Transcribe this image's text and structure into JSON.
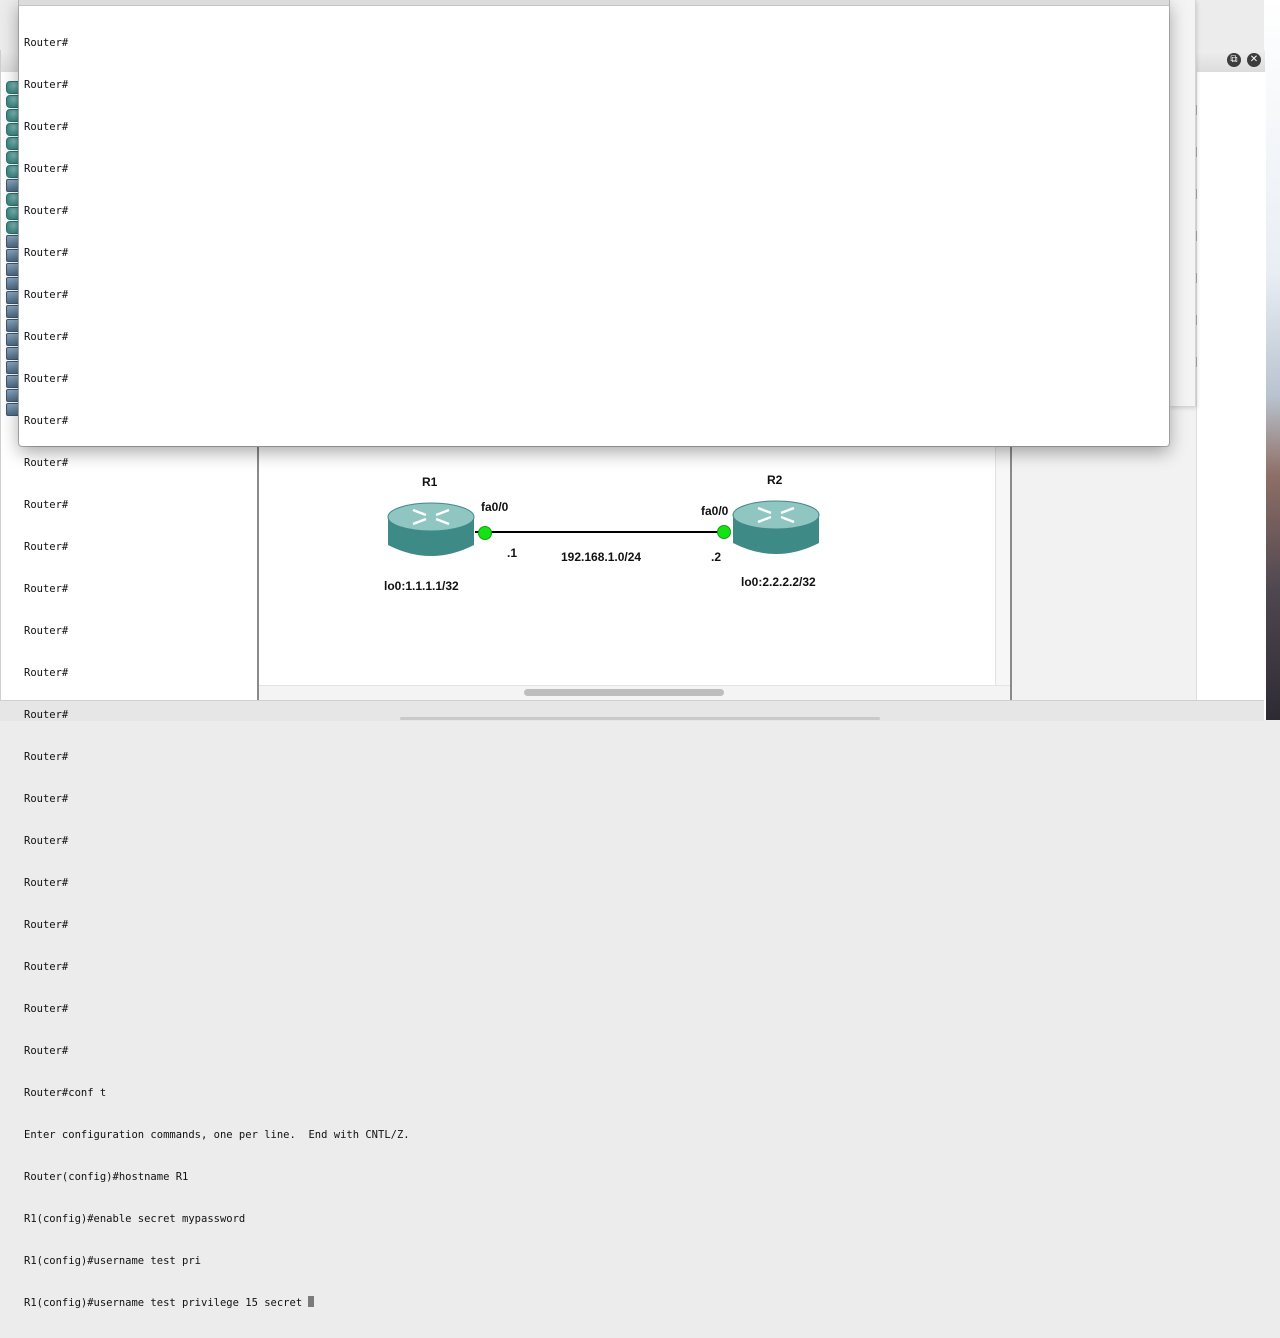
{
  "terminal": {
    "lines": [
      "Router#",
      "Router#",
      "Router#",
      "Router#",
      "Router#",
      "Router#",
      "Router#",
      "Router#",
      "Router#",
      "Router#",
      "Router#",
      "Router#",
      "Router#",
      "Router#",
      "Router#",
      "Router#",
      "Router#",
      "Router#",
      "Router#",
      "Router#",
      "Router#",
      "Router#",
      "Router#",
      "Router#",
      "Router#",
      "Router#conf t",
      "Enter configuration commands, one per line.  End with CNTL/Z.",
      "Router(config)#hostname R1",
      "R1(config)#enable secret mypassword",
      "R1(config)#username test pri",
      "R1(config)#username test privilege 15 secret "
    ]
  },
  "topology": {
    "routers": [
      {
        "name": "R1",
        "interface": "fa0/0",
        "address": ".1",
        "loopback": "lo0:1.1.1.1/32"
      },
      {
        "name": "R2",
        "interface": "fa0/0",
        "address": ".2",
        "loopback": "lo0:2.2.2.2/32"
      }
    ],
    "network": "192.168.1.0/24"
  },
  "window": {
    "restore_glyph": "⧉",
    "close_glyph": "✕"
  },
  "colors": {
    "port_up": "#14e214",
    "router_body": "#3e8a86"
  }
}
